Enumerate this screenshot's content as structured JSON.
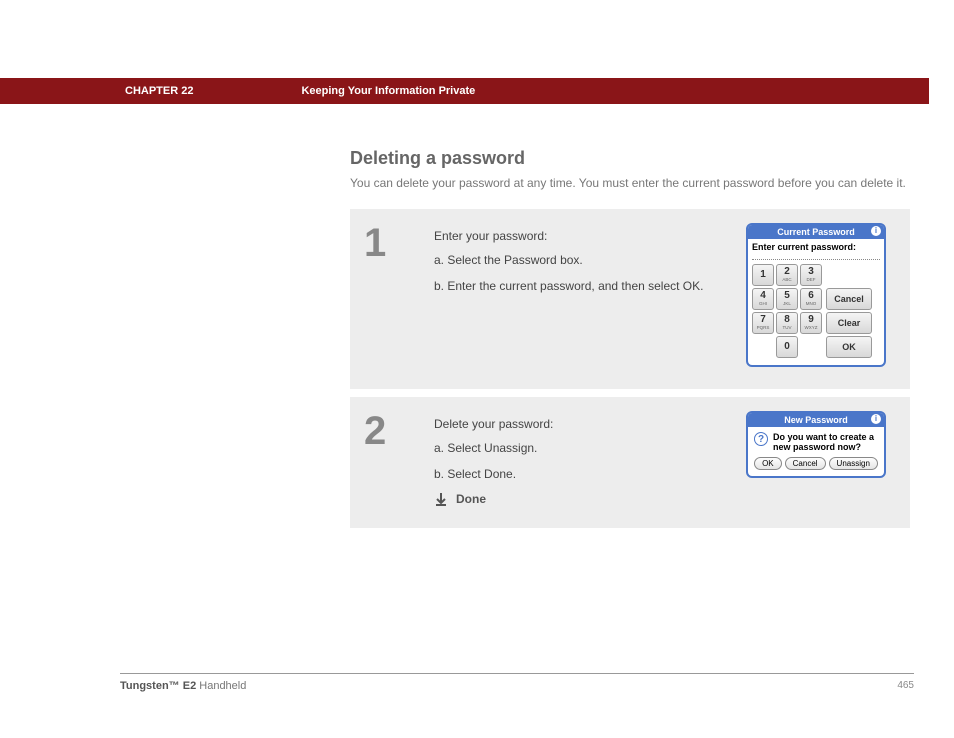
{
  "header": {
    "chapter": "CHAPTER 22",
    "section": "Keeping Your Information Private"
  },
  "page": {
    "title": "Deleting a password",
    "intro": "You can delete your password at any time. You must enter the current password before you can delete it."
  },
  "step1": {
    "num": "1",
    "title": "Enter your password:",
    "a": "a.  Select the Password box.",
    "b": "b.  Enter the current password, and then select OK.",
    "dlg": {
      "title": "Current Password",
      "prompt": "Enter current  password:",
      "keys": {
        "1": "1",
        "2": "2",
        "2s": "ABC",
        "3": "3",
        "3s": "DEF",
        "4": "4",
        "4s": "GHI",
        "5": "5",
        "5s": "JKL",
        "6": "6",
        "6s": "MNO",
        "7": "7",
        "7s": "PQRS",
        "8": "8",
        "8s": "TUV",
        "9": "9",
        "9s": "WXYZ",
        "0": "0"
      },
      "cancel": "Cancel",
      "clear": "Clear",
      "ok": "OK"
    }
  },
  "step2": {
    "num": "2",
    "title": "Delete your password:",
    "a": "a.  Select Unassign.",
    "b": "b.  Select Done.",
    "done": "Done",
    "dlg": {
      "title": "New Password",
      "question": "Do you want to create a new password now?",
      "ok": "OK",
      "cancel": "Cancel",
      "unassign": "Unassign"
    }
  },
  "footer": {
    "product_bold": "Tungsten™ E2",
    "product_rest": " Handheld",
    "page": "465"
  }
}
